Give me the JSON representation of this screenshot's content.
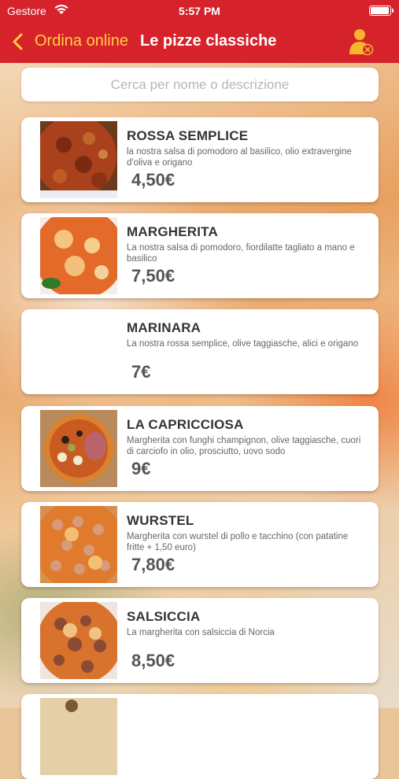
{
  "status_bar": {
    "carrier": "Gestore",
    "time": "5:57 PM",
    "battery_level": 0.9
  },
  "nav": {
    "back_label": "Ordina online",
    "title": "Le pizze classiche",
    "user_icon": "user-remove-icon"
  },
  "search": {
    "placeholder": "Cerca per nome o descrizione"
  },
  "colors": {
    "header": "#d6222b",
    "accent": "#ffd23f"
  },
  "items": [
    {
      "name": "ROSSA SEMPLICE",
      "description": "la nostra salsa di pomodoro al basilico, olio extravergine d'oliva e origano",
      "price": "4,50€",
      "image": "pizza-rossa"
    },
    {
      "name": "MARGHERITA",
      "description": "La nostra salsa di pomodoro, fiordilatte tagliato a mano e basilico",
      "price": "7,50€",
      "image": "pizza-margherita"
    },
    {
      "name": "MARINARA",
      "description": "La nostra rossa semplice, olive taggiasche, alici e origano",
      "price": "7€",
      "image": ""
    },
    {
      "name": "LA CAPRICCIOSA",
      "description": "Margherita con funghi champignon, olive taggiasche, cuori di carciofo in olio, prosciutto, uovo sodo",
      "price": "9€",
      "image": "pizza-capricciosa"
    },
    {
      "name": "WURSTEL",
      "description": "Margherita con wurstel di pollo e tacchino (con patatine fritte + 1,50 euro)",
      "price": "7,80€",
      "image": "pizza-wurstel"
    },
    {
      "name": "SALSICCIA",
      "description": "La margherita con salsiccia di Norcia",
      "price": "8,50€",
      "image": "pizza-salsiccia"
    }
  ]
}
